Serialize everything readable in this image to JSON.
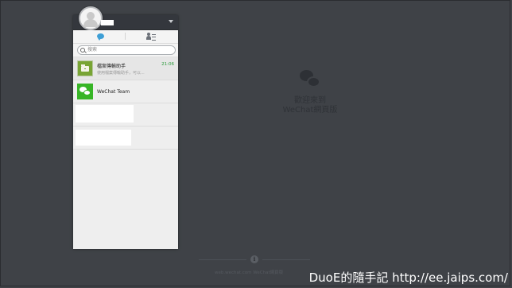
{
  "header": {
    "avatar": "user-avatar",
    "username": "",
    "menu_icon": "chevron-down-icon"
  },
  "tabs": [
    {
      "name": "chats",
      "icon": "chat-bubble-icon",
      "active": true
    },
    {
      "name": "contacts",
      "icon": "contacts-icon",
      "active": false
    }
  ],
  "search": {
    "placeholder": "搜索"
  },
  "chats": [
    {
      "title": "檔案傳輸助手",
      "preview": "使用檔案傳輸助手，可以...",
      "time": "21:06",
      "avatar_icon": "file-transfer-icon"
    },
    {
      "title": "WeChat Team",
      "preview": "",
      "time": "",
      "avatar_icon": "wechat-icon"
    }
  ],
  "redacted_rows": 2,
  "welcome": {
    "line1": "歡迎來到",
    "line2": "WeChat網頁版"
  },
  "footer": {
    "text": "web.wechat.com  WeChat網頁版"
  },
  "watermark": "DuoE的隨手記 http://ee.jaips.com/",
  "colors": {
    "background": "#3f4247",
    "panel": "#eeeeee",
    "accent_blue": "#3e9fd6",
    "wechat_green": "#37b526",
    "time_green": "#2a9a3a"
  }
}
